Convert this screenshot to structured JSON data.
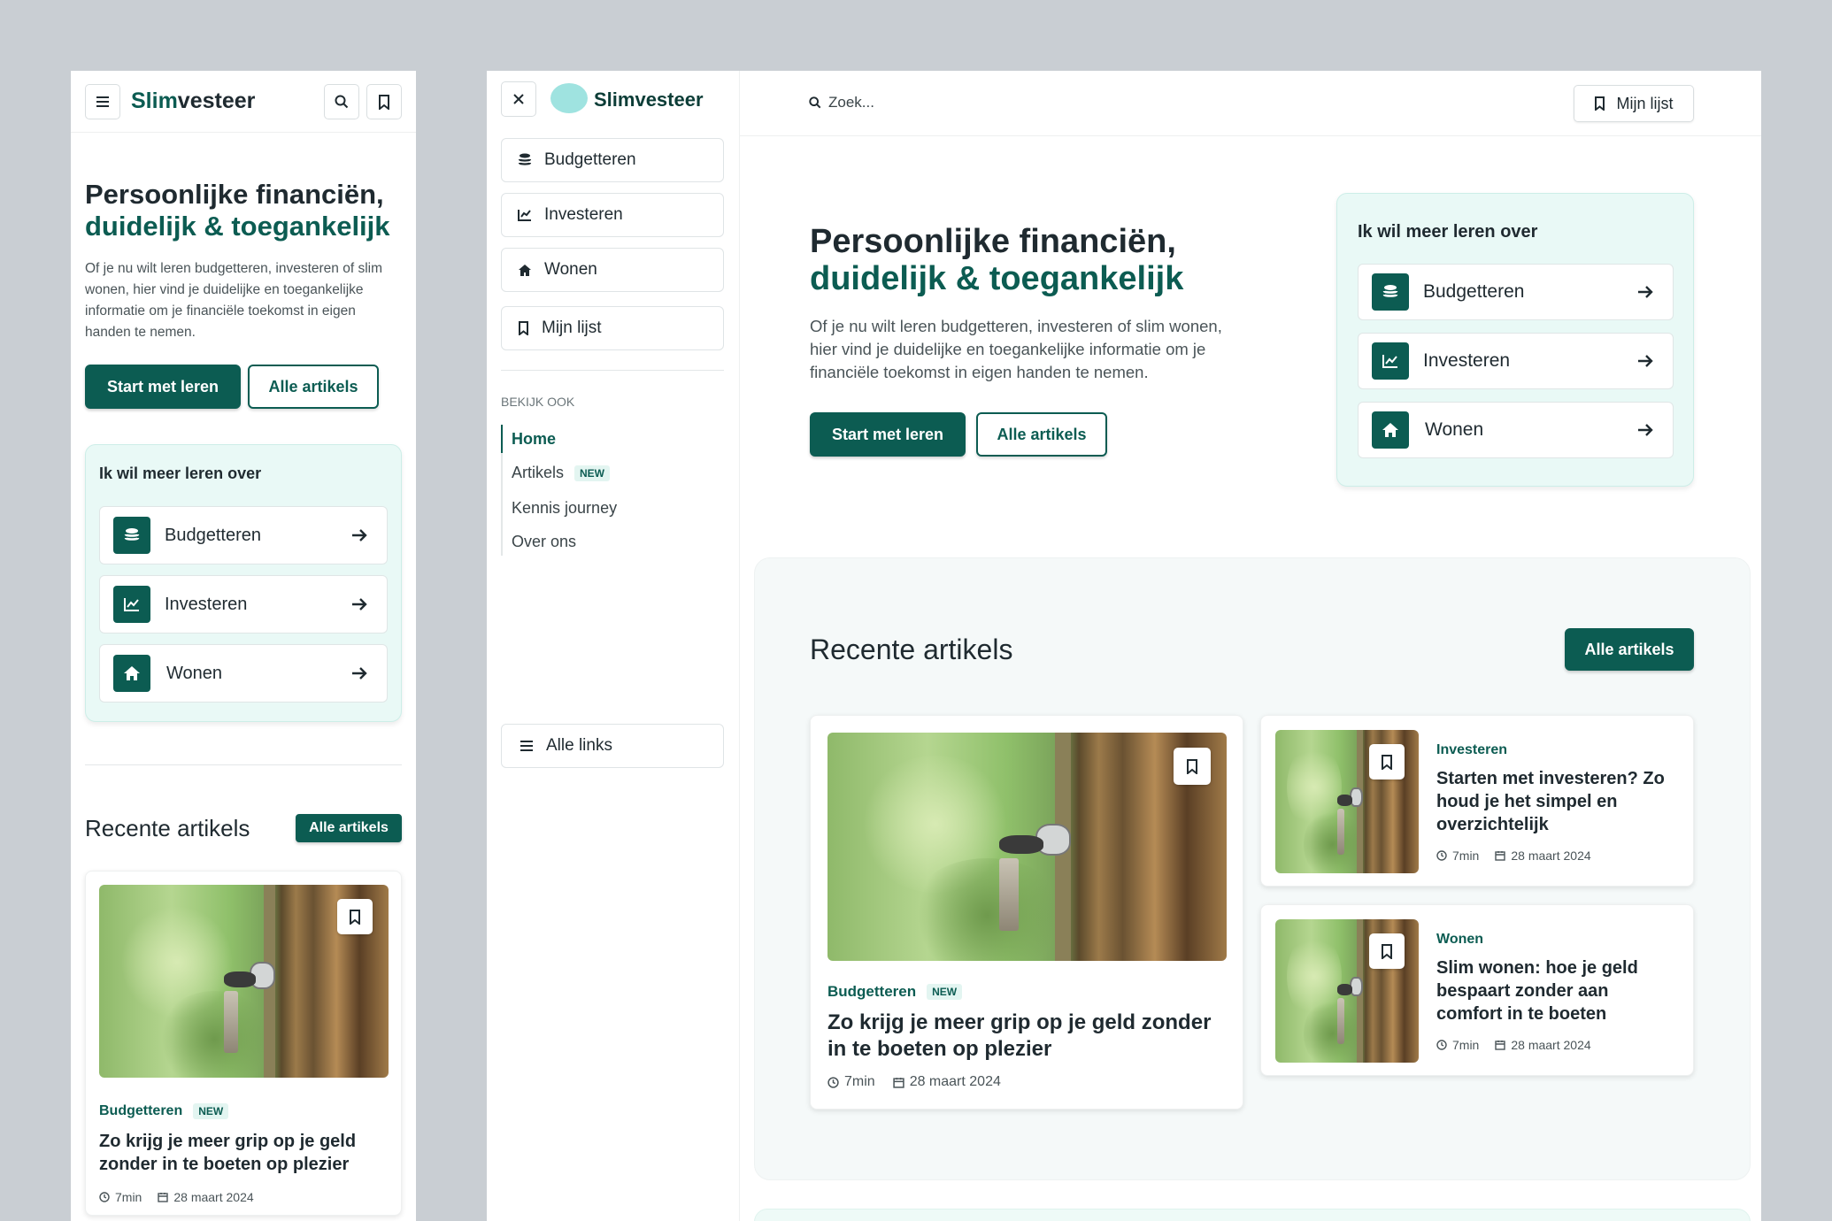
{
  "brand": {
    "name_part1": "Slim",
    "name_part2": "vesteer",
    "full_name": "Slimvesteer"
  },
  "hero": {
    "title_line1": "Persoonlijke financiën,",
    "title_line2": "duidelijk & toegankelijk",
    "body_mobile": "Of je nu wilt leren budgetteren, investeren of slim wonen, hier vind je duidelijke en toegankelijke informatie om je financiële toekomst in eigen handen te nemen.",
    "body_desktop": "Of je nu wilt leren budgetteren, investeren of slim wonen, hier vind je duidelijke en toegankelijke informatie om je financiële toekomst in eigen handen te nemen.",
    "primary_cta": "Start met leren",
    "secondary_cta": "Alle artikels"
  },
  "topics": {
    "heading": "Ik wil meer leren over",
    "items": [
      {
        "label": "Budgetteren",
        "icon": "coins-icon"
      },
      {
        "label": "Investeren",
        "icon": "chart-icon"
      },
      {
        "label": "Wonen",
        "icon": "home-icon"
      }
    ]
  },
  "recent": {
    "heading": "Recente artikels",
    "all_button": "Alle artikels",
    "featured": {
      "category": "Budgetteren",
      "badge": "NEW",
      "title": "Zo krijg je meer grip op je geld zonder in te boeten op plezier",
      "read_time": "7min",
      "date": "28 maart 2024"
    },
    "side_articles": [
      {
        "category": "Investeren",
        "title": "Starten met investeren? Zo houd je het simpel en overzichtelijk",
        "read_time": "7min",
        "date": "28 maart 2024"
      },
      {
        "category": "Wonen",
        "title": "Slim wonen: hoe je geld bespaart zonder aan comfort in te boeten",
        "read_time": "7min",
        "date": "28 maart 2024"
      }
    ]
  },
  "sidebar": {
    "nav": [
      {
        "label": "Budgetteren",
        "icon": "coins-icon"
      },
      {
        "label": "Investeren",
        "icon": "chart-icon"
      },
      {
        "label": "Wonen",
        "icon": "home-icon"
      },
      {
        "label": "Mijn lijst",
        "icon": "bookmark-icon"
      }
    ],
    "see_also_heading": "BEKIJK OOK",
    "links": [
      {
        "label": "Home",
        "active": true
      },
      {
        "label": "Artikels",
        "badge": "NEW"
      },
      {
        "label": "Kennis journey"
      },
      {
        "label": "Over ons"
      }
    ],
    "all_links": "Alle links"
  },
  "topbar": {
    "search_placeholder": "Zoek...",
    "my_list": "Mijn lijst"
  },
  "colors": {
    "brand": "#0c5c52",
    "mint": "#e9f9f6",
    "bg": "#c9ced3"
  }
}
